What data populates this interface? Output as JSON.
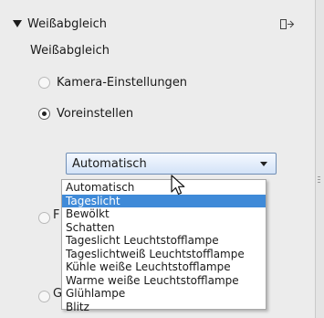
{
  "panel": {
    "title": "Weißabgleich",
    "section_label": "Weißabgleich",
    "icons": {
      "collapse": "collapse-triangle-icon",
      "pin": "panel-pin-icon"
    },
    "radio_options": [
      {
        "label": "Kamera-Einstellungen",
        "checked": false
      },
      {
        "label": "Voreinstellen",
        "checked": true
      }
    ],
    "partially_hidden_options": [
      {
        "visible_letter": "F"
      },
      {
        "visible_letter": "G"
      }
    ]
  },
  "preset_dropdown": {
    "selected_value": "Automatisch",
    "options": [
      "Automatisch",
      "Tageslicht",
      "Bewölkt",
      "Schatten",
      "Tageslicht Leuchtstofflampe",
      "Tageslichtweiß Leuchtstofflampe",
      "Kühle weiße Leuchtstofflampe",
      "Warme weiße Leuchtstofflampe",
      "Glühlampe",
      "Blitz"
    ],
    "hovered_index": 1
  },
  "colors": {
    "panel_bg": "#ececec",
    "highlight": "#3f8ad8",
    "dropdown_border": "#6f8eb5"
  }
}
